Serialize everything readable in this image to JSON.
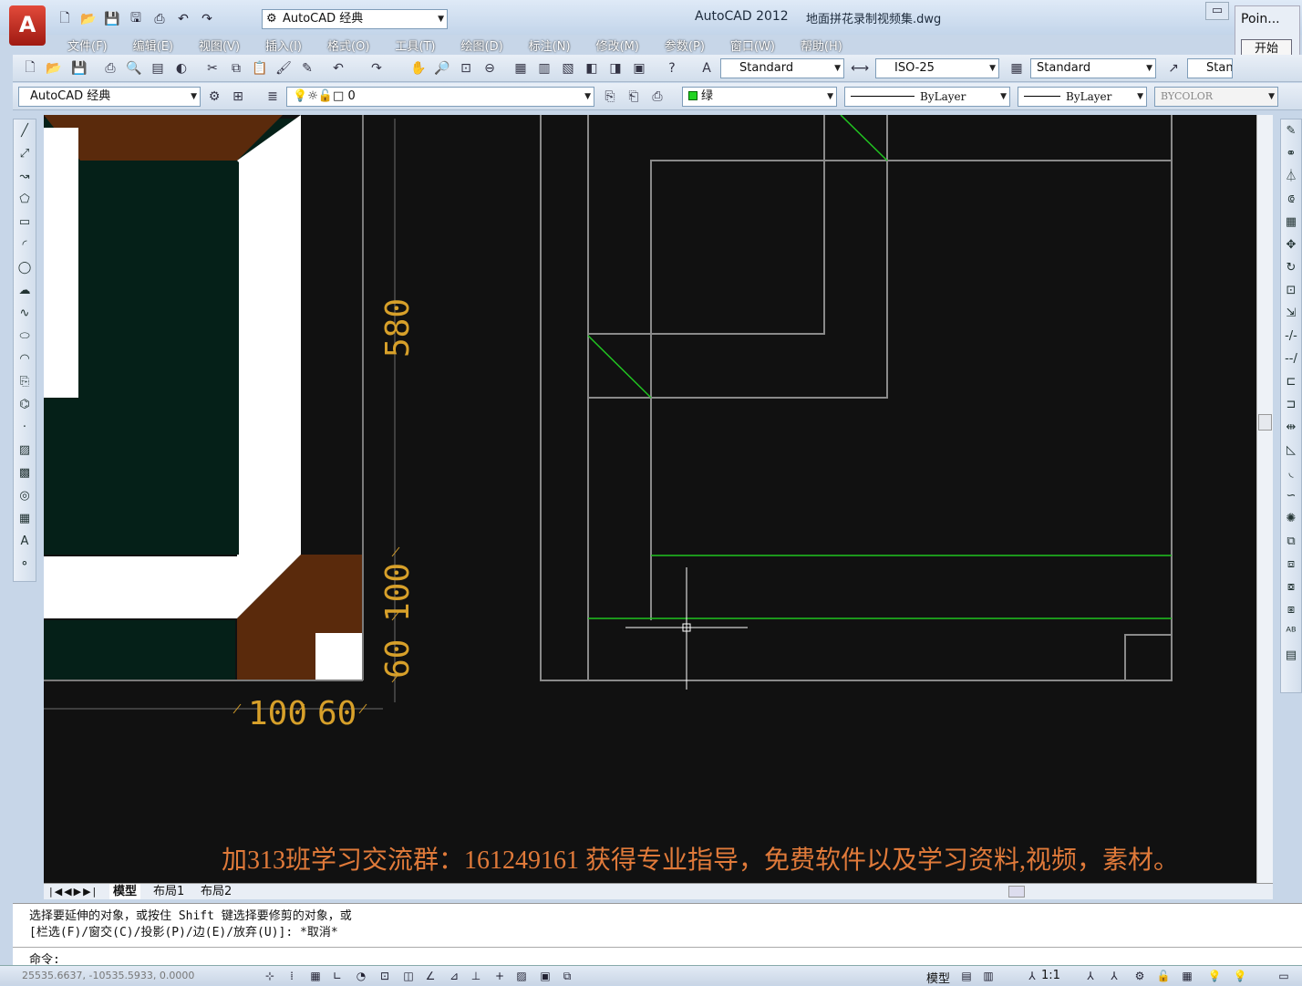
{
  "app": {
    "title": "AutoCAD 2012",
    "file": "地面拼花录制视频集.dwg",
    "logo": "A"
  },
  "workspace": "AutoCAD 经典",
  "window": {
    "minimize": "▭",
    "restore": "⧉",
    "close": "✕"
  },
  "side_panel": {
    "title": "Poin...",
    "start": "开始"
  },
  "menus": [
    "文件(F)",
    "编辑(E)",
    "视图(V)",
    "插入(I)",
    "格式(O)",
    "工具(T)",
    "绘图(D)",
    "标注(N)",
    "修改(M)",
    "参数(P)",
    "窗口(W)",
    "帮助(H)"
  ],
  "styles": {
    "text_style": "Standard",
    "dim_style": "ISO-25",
    "table_style": "Standard",
    "multileader_style": "Standard"
  },
  "layers": {
    "workspace": "AutoCAD 经典",
    "current_layer": "0",
    "color": "绿",
    "linetype": "ByLayer",
    "lineweight": "ByLayer",
    "plotstyle": "BYCOLOR"
  },
  "colors": {
    "canvas": "#111111",
    "green": "#21c421",
    "brown": "#5a2a0c",
    "dark_fill": "#052018",
    "dim": "#d7a02a",
    "gray": "#808080"
  },
  "dimensions": {
    "d580": "580",
    "d100v": "100",
    "d60v": "60",
    "d100h": "100",
    "d60h": "60"
  },
  "overlay_text": "加313班学习交流群：161249161 获得专业指导，免费软件以及学习资料,视频，素材。",
  "tabs": [
    "模型",
    "布局1",
    "布局2"
  ],
  "command": {
    "line1": "选择要延伸的对象，或按住 Shift 键选择要修剪的对象，或",
    "line2": "[栏选(F)/窗交(C)/投影(P)/边(E)/放弃(U)]:  *取消*",
    "prompt": "命令:"
  },
  "status": {
    "coords": "25535.6637, -10535.5933, 0.0000",
    "model": "模型",
    "scale": "1:1"
  }
}
